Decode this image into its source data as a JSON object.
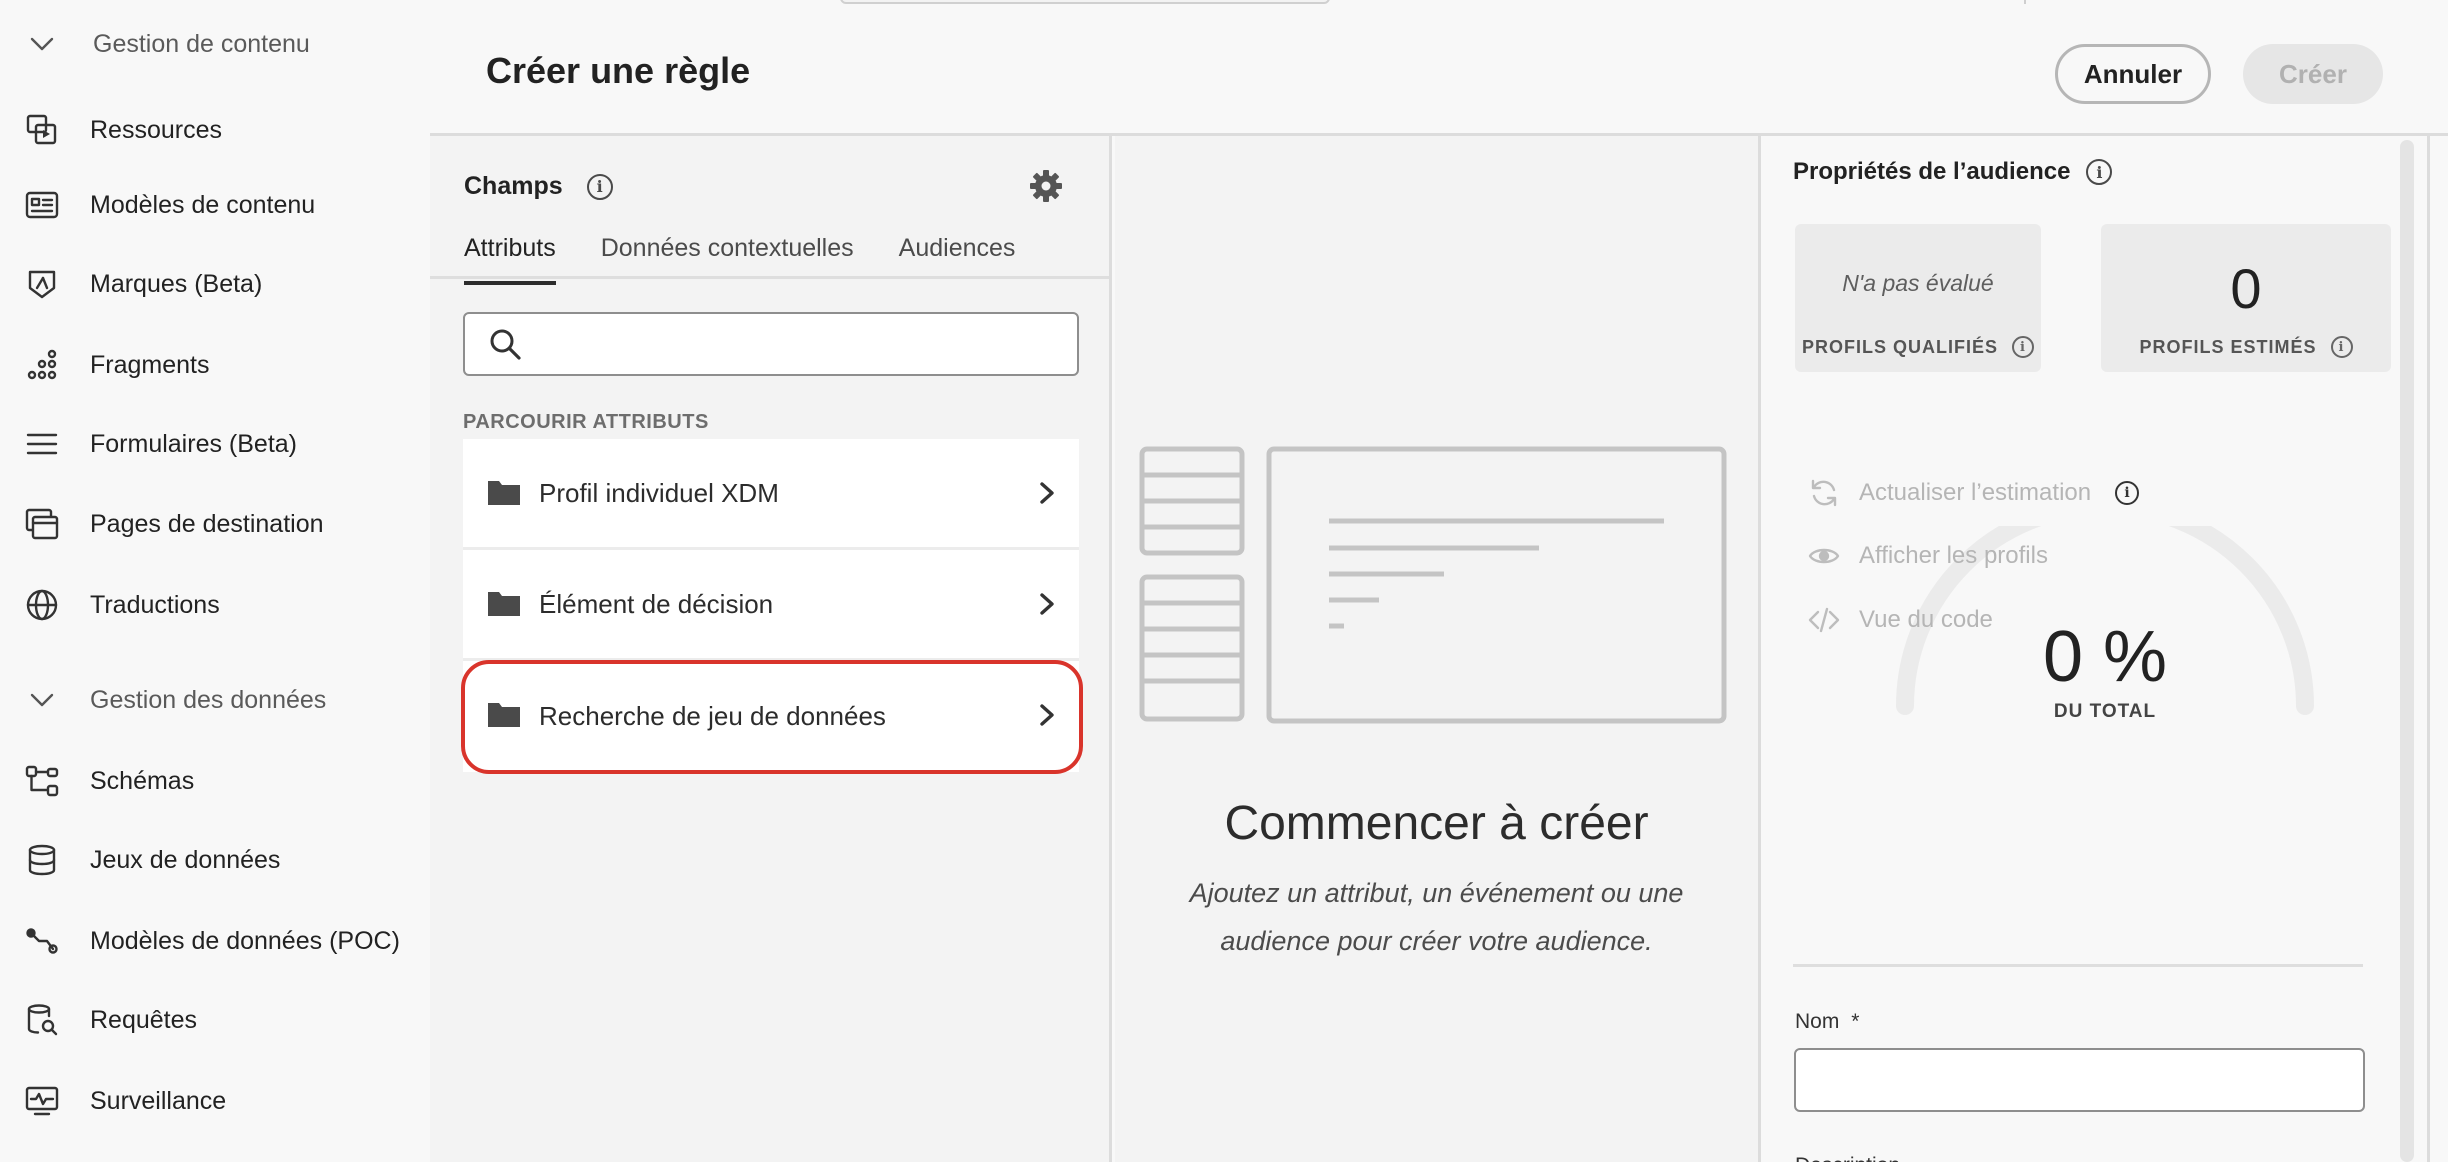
{
  "sidebar": {
    "items": [
      {
        "label": "Gestion de contenu",
        "icon": "chevron-down-icon",
        "section": true
      },
      {
        "label": "Ressources",
        "icon": "assets-icon"
      },
      {
        "label": "Modèles de contenu",
        "icon": "content-template-icon"
      },
      {
        "label": "Marques (Beta)",
        "icon": "brand-icon"
      },
      {
        "label": "Fragments",
        "icon": "fragments-icon"
      },
      {
        "label": "Formulaires (Beta)",
        "icon": "forms-icon"
      },
      {
        "label": "Pages de destination",
        "icon": "landing-pages-icon"
      },
      {
        "label": "Traductions",
        "icon": "globe-icon"
      },
      {
        "label": "Gestion des données",
        "icon": "chevron-down-icon",
        "section": true
      },
      {
        "label": "Schémas",
        "icon": "schema-icon"
      },
      {
        "label": "Jeux de données",
        "icon": "database-icon"
      },
      {
        "label": "Modèles de données (POC)",
        "icon": "data-model-icon"
      },
      {
        "label": "Requêtes",
        "icon": "query-icon"
      },
      {
        "label": "Surveillance",
        "icon": "monitoring-icon"
      }
    ]
  },
  "header": {
    "title": "Créer une règle",
    "cancel_label": "Annuler",
    "create_label": "Créer"
  },
  "fields": {
    "title": "Champs",
    "tabs": [
      "Attributs",
      "Données contextuelles",
      "Audiences"
    ],
    "active_tab": "Attributs",
    "search": {
      "value": "",
      "placeholder": ""
    },
    "browse_label": "PARCOURIR ATTRIBUTS",
    "folders": [
      "Profil individuel XDM",
      "Élément de décision",
      "Recherche de jeu de données"
    ],
    "highlighted_folder": "Recherche de jeu de données"
  },
  "canvas": {
    "title": "Commencer à créer",
    "subtitle_line1": "Ajoutez un attribut, un événement ou une",
    "subtitle_line2": "audience pour créer votre audience."
  },
  "properties": {
    "title": "Propriétés de l’audience",
    "qualified": {
      "value": "N'a pas évalué",
      "caption": "PROFILS QUALIFIÉS"
    },
    "estimated": {
      "value": "0",
      "caption": "PROFILS ESTIMÉS"
    },
    "gauge": {
      "value": "0 %",
      "caption": "DU TOTAL",
      "fraction": 0
    },
    "actions": [
      {
        "label": "Actualiser l’estimation",
        "icon": "refresh-icon"
      },
      {
        "label": "Afficher les profils",
        "icon": "eye-icon"
      },
      {
        "label": "Vue du code",
        "icon": "code-icon"
      }
    ],
    "name_label": "Nom",
    "name_required": "*",
    "name_value": "",
    "desc_label": "Description"
  },
  "colors": {
    "highlight": "#d9342b",
    "background": "#f8f8f8",
    "panel": "#f3f3f3"
  }
}
